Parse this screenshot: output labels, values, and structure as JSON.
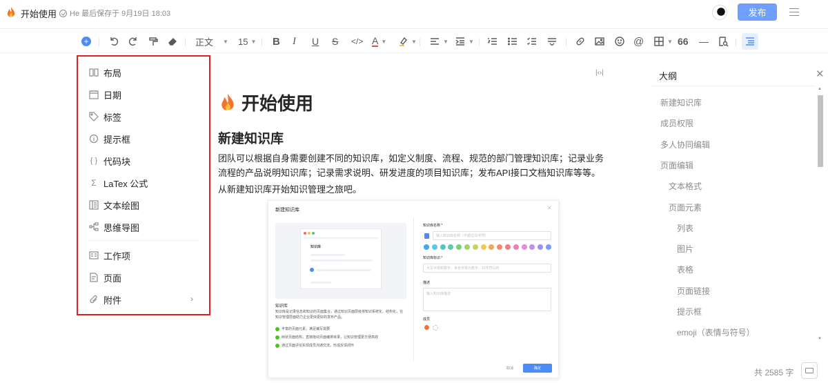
{
  "header": {
    "title": "开始使用",
    "save_status": "He 最后保存于 9月19日 18:03",
    "publish_label": "发布"
  },
  "toolbar": {
    "font_style": "正文",
    "font_size": "15",
    "quote_glyph": "66",
    "divider_glyph": "—"
  },
  "insert_menu": {
    "items": [
      {
        "label": "布局",
        "icon": "layout-icon"
      },
      {
        "label": "日期",
        "icon": "calendar-icon"
      },
      {
        "label": "标签",
        "icon": "tag-icon"
      },
      {
        "label": "提示框",
        "icon": "info-icon"
      },
      {
        "label": "代码块",
        "icon": "code-braces-icon"
      },
      {
        "label": "LaTex 公式",
        "icon": "sigma-icon"
      },
      {
        "label": "文本绘图",
        "icon": "text-drawing-icon"
      },
      {
        "label": "思维导图",
        "icon": "mindmap-icon"
      },
      {
        "label": "工作项",
        "icon": "workitem-icon"
      },
      {
        "label": "页面",
        "icon": "page-icon"
      },
      {
        "label": "附件",
        "icon": "paperclip-icon"
      }
    ]
  },
  "document": {
    "title": "开始使用",
    "heading": "新建知识库",
    "paragraph": "团队可以根据自身需要创建不同的知识库，如定义制度、流程、规范的部门管理知识库；记录业务流程的产品说明知识库；记录需求说明、研发进度的项目知识库；发布API接口文档知识库等等。",
    "paragraph2": "从新建知识库开始知识管理之旅吧。"
  },
  "dialog": {
    "title": "新建知识库",
    "card_title": "知识库",
    "left_heading": "知识库",
    "left_desc": "知识库是记录信息和知识的页面集合，通过知识页面层级将知识系统化、结构化，在知识管理层面助力企业更快更好的发布产品。",
    "bullets": [
      "丰富的页面元素，满足编写需要",
      "树状页面结构，直接拖动页面编排目录，让知识管理更方便高效",
      "通过页面评论实现成员沟通交流，形成反馈闭环"
    ],
    "name_label": "知识库名称 *",
    "name_placeholder": "输入知识库名称（不超过32字符）",
    "id_label": "知识库标识 *",
    "id_placeholder": "大写字母和数字，未也字母为数字，10字符以内",
    "desc_label": "描述",
    "desc_placeholder": "输入知识库描述",
    "members_label": "成员",
    "cancel": "取消",
    "ok": "确定",
    "swatch_colors": [
      "#3ea8f5",
      "#5bc8e8",
      "#56c7c0",
      "#60c9a8",
      "#7ad07a",
      "#9ad46a",
      "#c6d65c",
      "#f2c94c",
      "#f6a85a",
      "#f48a6a",
      "#f17a86",
      "#ef7fb0",
      "#e88bd8",
      "#c38ef0",
      "#9b93f2",
      "#7f9cf5"
    ]
  },
  "outline": {
    "title": "大纲",
    "items": [
      {
        "label": "新建知识库",
        "level": 1
      },
      {
        "label": "成员权限",
        "level": 1
      },
      {
        "label": "多人协同编辑",
        "level": 1
      },
      {
        "label": "页面编辑",
        "level": 1
      },
      {
        "label": "文本格式",
        "level": 2
      },
      {
        "label": "页面元素",
        "level": 2
      },
      {
        "label": "列表",
        "level": 3
      },
      {
        "label": "图片",
        "level": 3
      },
      {
        "label": "表格",
        "level": 3
      },
      {
        "label": "页面链接",
        "level": 3
      },
      {
        "label": "提示框",
        "level": 3
      },
      {
        "label": "emoji（表情与符号）",
        "level": 3
      }
    ]
  },
  "footer": {
    "word_count": "共 2585 字"
  }
}
